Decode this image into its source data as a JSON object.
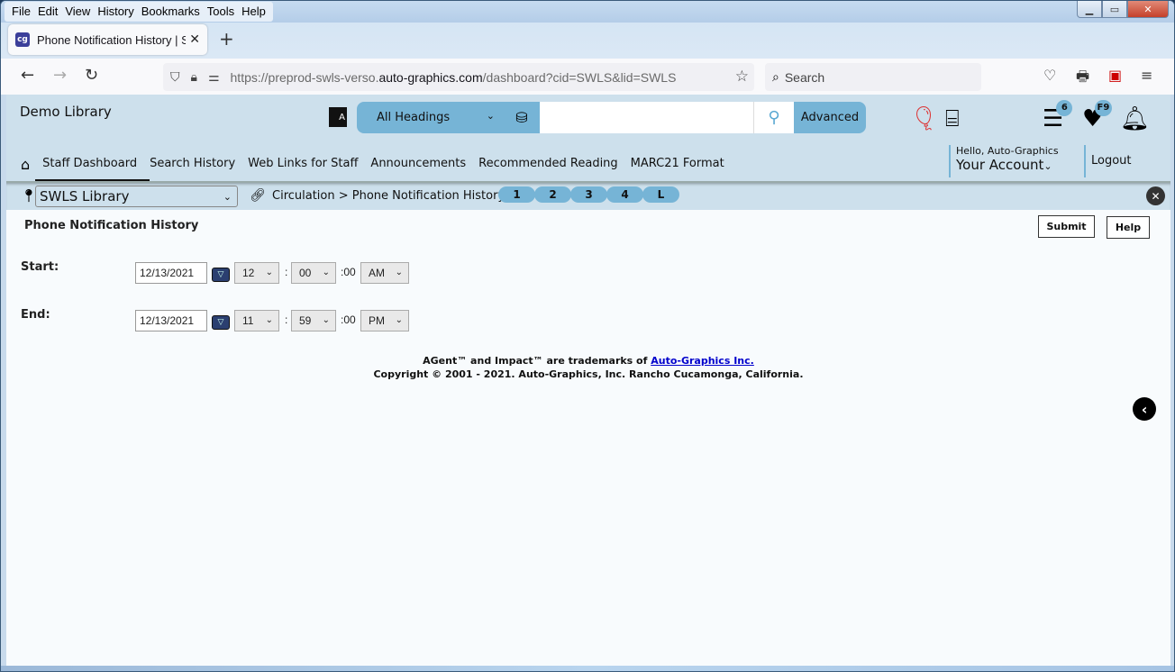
{
  "browser": {
    "menu": [
      "File",
      "Edit",
      "View",
      "History",
      "Bookmarks",
      "Tools",
      "Help"
    ],
    "tab_title": "Phone Notification History | SWLS",
    "favicon_text": "cg",
    "url_prefix": "https://preprod-swls-verso.",
    "url_domain": "auto-graphics.com",
    "url_suffix": "/dashboard?cid=SWLS&lid=SWLS",
    "search_placeholder": "Search"
  },
  "header": {
    "library_name": "Demo Library",
    "search": {
      "scope": "All Headings",
      "query": "",
      "advanced_label": "Advanced"
    },
    "badges": {
      "list_count": "6",
      "favorites": "F9"
    },
    "nav": [
      "Staff Dashboard",
      "Search History",
      "Web Links for Staff",
      "Announcements",
      "Recommended Reading",
      "MARC21 Format"
    ],
    "active_nav": "Staff Dashboard",
    "greeting": "Hello, Auto-Graphics",
    "account_label": "Your Account",
    "logout_label": "Logout"
  },
  "subbar": {
    "library_select": "SWLS Library",
    "breadcrumb": "Circulation > Phone Notification History",
    "quick_buttons": [
      "1",
      "2",
      "3",
      "4",
      "L"
    ]
  },
  "page": {
    "title": "Phone Notification History",
    "submit_label": "Submit",
    "help_label": "Help",
    "start": {
      "label": "Start:",
      "date": "12/13/2021",
      "hour": "12",
      "minute": "00",
      "seconds": ":00",
      "ampm": "AM"
    },
    "end": {
      "label": "End:",
      "date": "12/13/2021",
      "hour": "11",
      "minute": "59",
      "seconds": ":00",
      "ampm": "PM"
    }
  },
  "footer": {
    "line1_prefix": "AGent™ and Impact™ are trademarks of ",
    "line1_link": "Auto-Graphics Inc.",
    "line2": "Copyright © 2001 - 2021. Auto-Graphics, Inc. Rancho Cucamonga, California."
  }
}
